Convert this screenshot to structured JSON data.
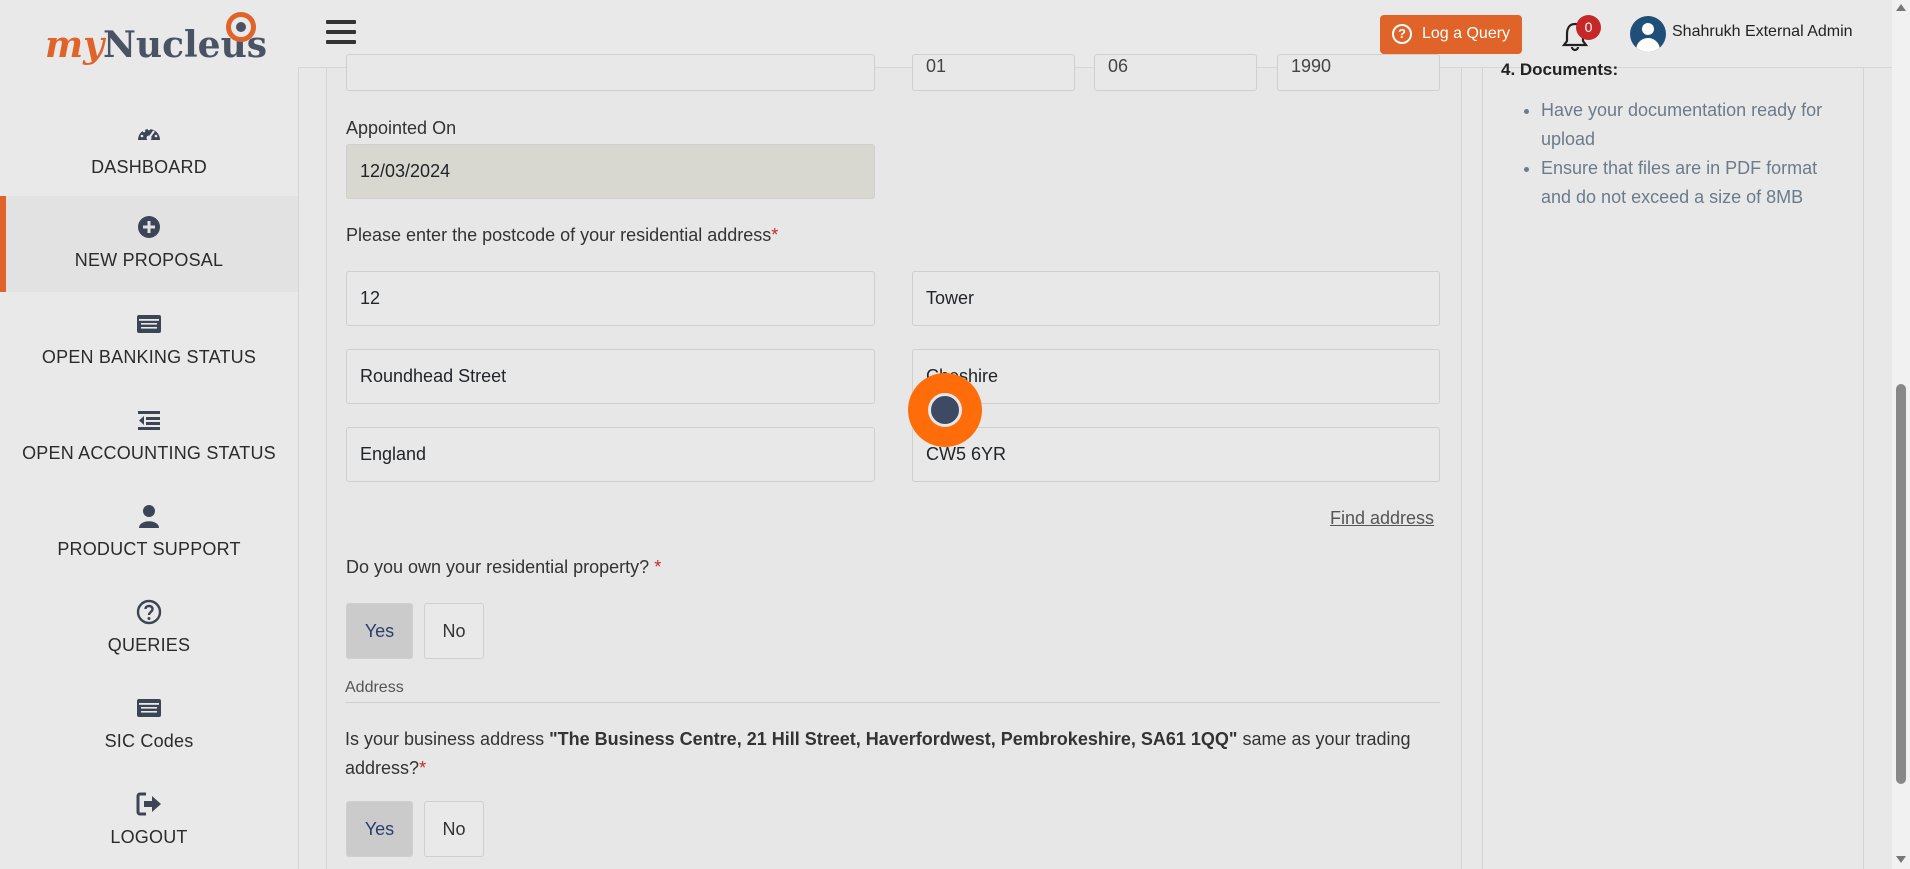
{
  "app": {
    "logo_prefix": "my",
    "logo_name": "Nucleus"
  },
  "sidebar": {
    "items": [
      {
        "label": "DASHBOARD",
        "icon": "dashboard-gauge-icon"
      },
      {
        "label": "NEW PROPOSAL",
        "icon": "plus-circle-icon",
        "active": true
      },
      {
        "label": "OPEN BANKING STATUS",
        "icon": "list-card-icon"
      },
      {
        "label": "OPEN ACCOUNTING STATUS",
        "icon": "indent-list-icon"
      },
      {
        "label": "PRODUCT SUPPORT",
        "icon": "user-icon"
      },
      {
        "label": "QUERIES",
        "icon": "question-circle-icon"
      },
      {
        "label": "SIC Codes",
        "icon": "list-card-icon"
      },
      {
        "label": "LOGOUT",
        "icon": "sign-out-icon"
      }
    ]
  },
  "header": {
    "log_query_label": "Log a Query",
    "notification_count": "0",
    "user_name": "Shahrukh External Admin"
  },
  "form": {
    "top_partial": {
      "dob_day": "01",
      "dob_month": "06",
      "dob_year": "1990"
    },
    "appointed_on_label": "Appointed On",
    "appointed_on_value": "12/03/2024",
    "postcode_question": "Please enter the postcode of your residential address",
    "required_mark": "*",
    "address_fields": {
      "line1": "12",
      "line2": "Tower",
      "street": "Roundhead Street",
      "county": "Cheshire",
      "country": "England",
      "postcode": "CW5 6YR"
    },
    "find_address_label": "Find address",
    "own_property_question": "Do you own your residential property?",
    "own_property_yes": "Yes",
    "own_property_no": "No",
    "own_property_selected": "Yes",
    "address_section_label": "Address",
    "business_address_prefix": "Is your business address ",
    "business_address_value": "\"The Business Centre, 21 Hill Street, Haverfordwest, Pembrokeshire, SA61 1QQ\"",
    "business_address_suffix": " same as your trading",
    "business_address_suffix2": "address?",
    "business_yes": "Yes",
    "business_no": "No",
    "business_selected": "Yes"
  },
  "right_panel": {
    "title": "4. Documents:",
    "items": [
      "Have your documentation ready for upload",
      "Ensure that files are in PDF format and do not exceed a size of 8MB"
    ]
  },
  "colors": {
    "accent": "#e0642a",
    "brand_dark": "#4a5364",
    "badge": "#c62828"
  }
}
